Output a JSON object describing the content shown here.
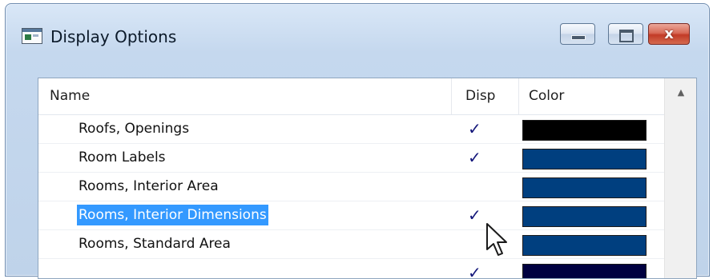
{
  "window": {
    "title": "Display Options",
    "icon": "app-window-icon",
    "buttons": {
      "minimize": "minimize-icon",
      "maximize": "maximize-icon",
      "close_glyph": "x"
    }
  },
  "list": {
    "columns": {
      "name": "Name",
      "disp": "Disp",
      "color": "Color"
    },
    "rows": [
      {
        "name": "Roofs, Openings",
        "disp": "✓",
        "color": "#000000",
        "selected": false
      },
      {
        "name": "Room Labels",
        "disp": "✓",
        "color": "#003f7f",
        "selected": false
      },
      {
        "name": "Rooms, Interior Area",
        "disp": "",
        "color": "#003f7f",
        "selected": false
      },
      {
        "name": "Rooms, Interior Dimensions",
        "disp": "✓",
        "color": "#003f7f",
        "selected": true
      },
      {
        "name": "Rooms, Standard Area",
        "disp": "",
        "color": "#003f7f",
        "selected": false
      },
      {
        "name": "",
        "disp": "✓",
        "color": "#000040",
        "selected": false
      }
    ],
    "scroll_up_icon": "chevron-up-icon"
  },
  "colors": {
    "selection": "#3399ff",
    "checkmark": "#13167a",
    "close_button": "#c23b27"
  }
}
